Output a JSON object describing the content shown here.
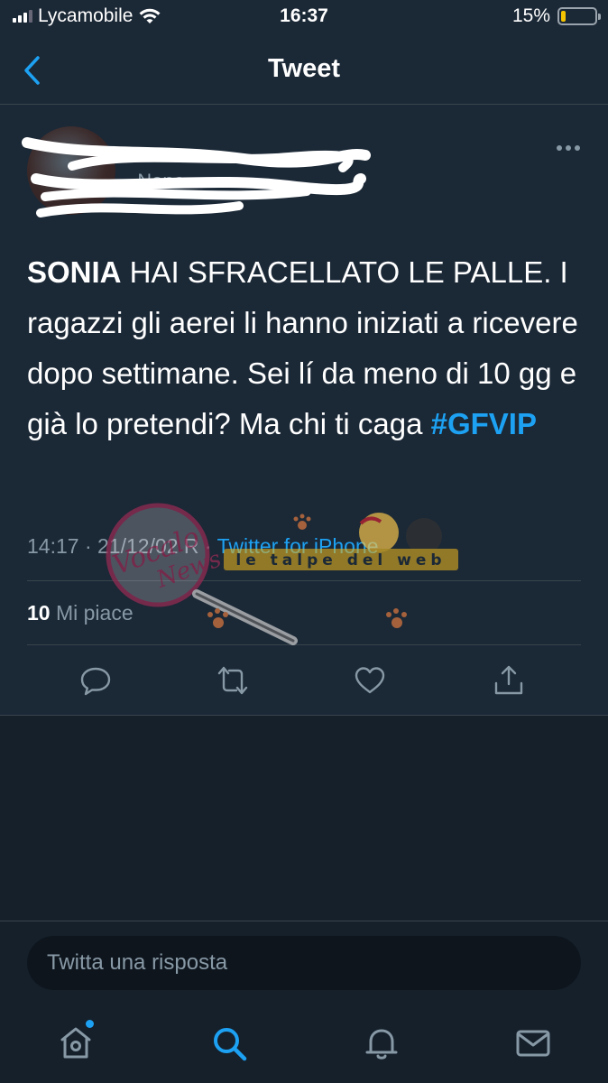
{
  "status_bar": {
    "carrier": "Lycamobile",
    "time": "16:37",
    "battery_percent": "15%",
    "battery_level": 0.15
  },
  "header": {
    "title": "Tweet"
  },
  "tweet": {
    "author_name": "",
    "author_handle": "_Nene_",
    "text_bold": "SONIA",
    "text_body": " HAI SFRACELLATO LE PALLE. I ragazzi gli aerei li hanno iniziati a ricevere dopo settimane. Sei lí da meno di 10 gg e già lo pretendi? Ma chi ti caga ",
    "hashtag": "#GFVIP",
    "time": "14:17",
    "date": "21/12/02",
    "source": "Twitter for iPhone",
    "likes_count": "10",
    "likes_label": "Mi piace",
    "watermark_text": "le talpe del web",
    "watermark_logo": "Vocalo dalla News"
  },
  "reply": {
    "placeholder": "Twitta una risposta"
  },
  "tabbar": {
    "items": [
      "home-icon",
      "search-icon",
      "notifications-icon",
      "messages-icon"
    ]
  },
  "colors": {
    "accent": "#1da1f2",
    "background": "#15202b",
    "card": "#1b2836",
    "muted": "#8899a6",
    "battery": "#f5c400"
  }
}
